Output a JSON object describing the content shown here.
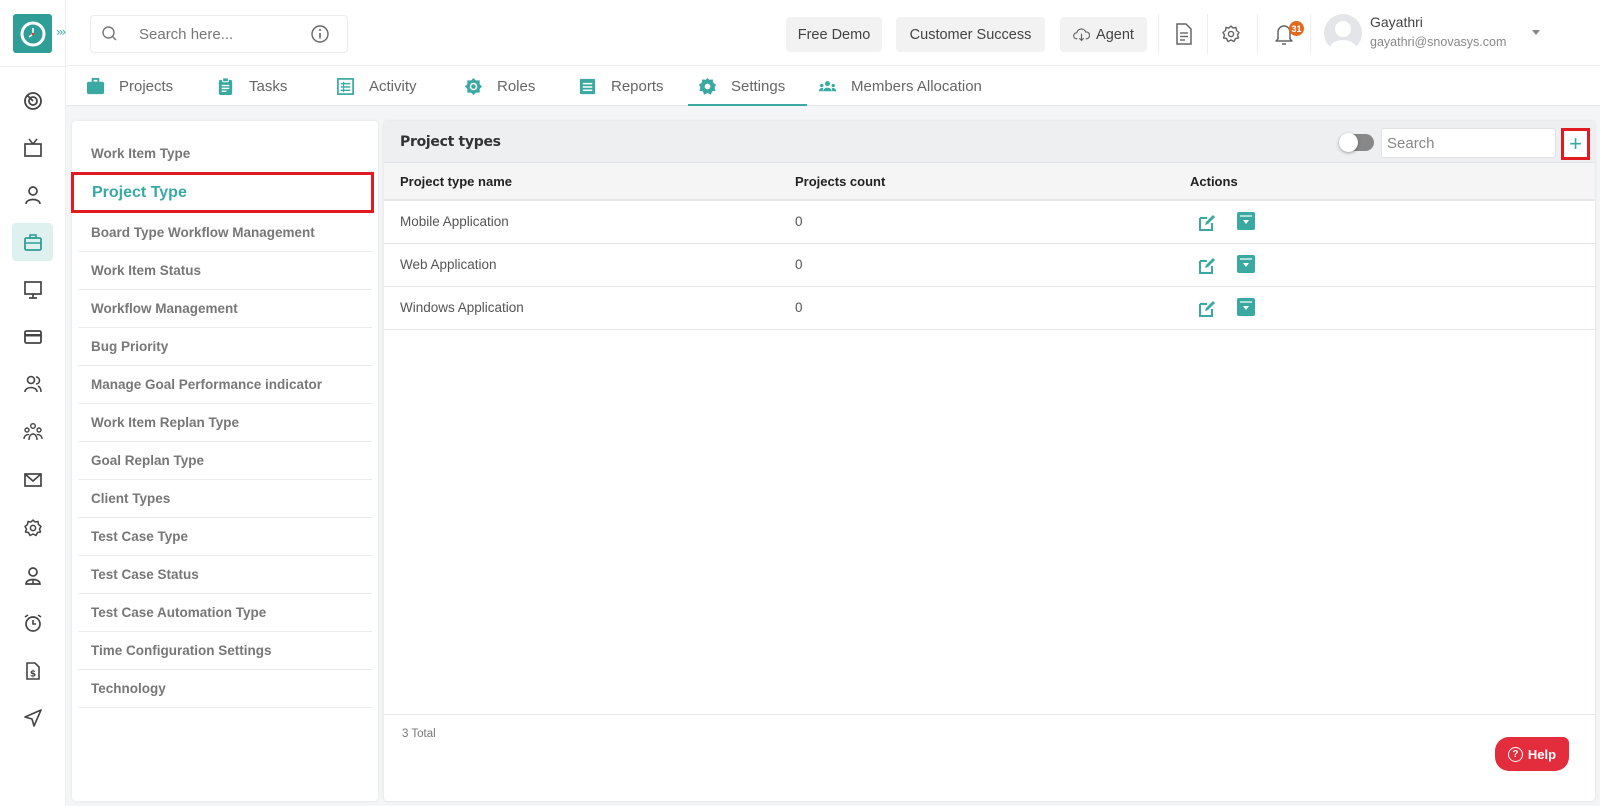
{
  "app": {
    "logo_icon": "clock-logo-icon",
    "expand_icon": "triple-chevron-right-icon",
    "brand_color": "#2e9e96",
    "accent_color": "#3aa9a1",
    "highlight_color": "#e21b22"
  },
  "topbar": {
    "search_placeholder": "Search here...",
    "search_icon": "search-icon",
    "info_icon": "info-icon",
    "free_demo_label": "Free Demo",
    "customer_success_label": "Customer Success",
    "agent_label": "Agent",
    "agent_icon": "cloud-download-icon",
    "document_icon": "document-icon",
    "settings_icon": "gear-icon",
    "bell_icon": "bell-icon",
    "notification_count": "31",
    "user": {
      "name": "Gayathri",
      "email": "gayathri@snovasys.com"
    }
  },
  "rail": {
    "items": [
      {
        "icon": "target-icon"
      },
      {
        "icon": "tv-icon"
      },
      {
        "icon": "user-icon"
      },
      {
        "icon": "briefcase-icon",
        "active": true
      },
      {
        "icon": "monitor-icon"
      },
      {
        "icon": "credit-card-icon"
      },
      {
        "icon": "users-icon"
      },
      {
        "icon": "team-icon"
      },
      {
        "icon": "mail-icon"
      },
      {
        "icon": "gear-icon"
      },
      {
        "icon": "user-badge-icon"
      },
      {
        "icon": "alarm-clock-icon"
      },
      {
        "icon": "invoice-icon"
      },
      {
        "icon": "send-icon"
      }
    ]
  },
  "tabs": [
    {
      "label": "Projects",
      "icon": "briefcase-icon"
    },
    {
      "label": "Tasks",
      "icon": "clipboard-icon"
    },
    {
      "label": "Activity",
      "icon": "list-icon"
    },
    {
      "label": "Roles",
      "icon": "roles-gear-icon"
    },
    {
      "label": "Reports",
      "icon": "report-icon"
    },
    {
      "label": "Settings",
      "icon": "gear-icon",
      "active": true
    },
    {
      "label": "Members Allocation",
      "icon": "members-icon"
    }
  ],
  "settings_menu": {
    "items": [
      "Work Item Type",
      "Project Type",
      "Board Type Workflow Management",
      "Work Item Status",
      "Workflow Management",
      "Bug Priority",
      "Manage Goal Performance indicator",
      "Work Item Replan Type",
      "Goal Replan Type",
      "Client Types",
      "Test Case Type",
      "Test Case Status",
      "Test Case Automation Type",
      "Time Configuration Settings",
      "Technology"
    ],
    "active": "Project Type"
  },
  "project_types": {
    "title": "Project types",
    "search_placeholder": "Search",
    "add_label": "+",
    "columns": [
      "Project type name",
      "Projects count",
      "Actions"
    ],
    "rows": [
      {
        "name": "Mobile Application",
        "count": "0"
      },
      {
        "name": "Web Application",
        "count": "0"
      },
      {
        "name": "Windows Application",
        "count": "0"
      }
    ],
    "total_label": "3 Total"
  },
  "help": {
    "label": "Help",
    "icon_glyph": "?"
  }
}
